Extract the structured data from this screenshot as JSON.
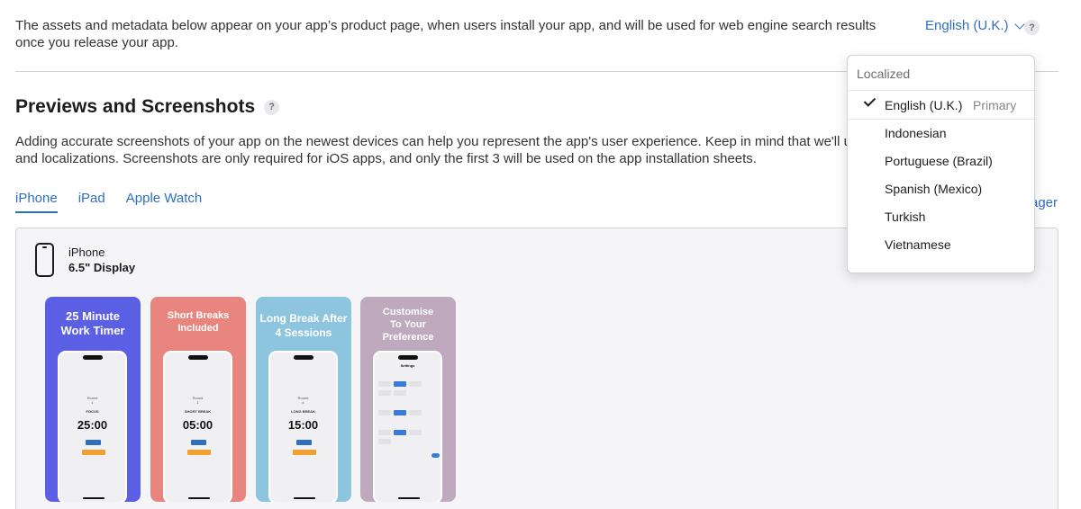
{
  "header": {
    "intro_text": "The assets and metadata below appear on your app’s product page, when users install your app, and will be used for web engine search results once you release your app.",
    "language_selected": "English (U.K.)",
    "help_glyph": "?"
  },
  "section": {
    "title": "Previews and Screenshots",
    "help_glyph": "?",
    "description": "Adding accurate screenshots of your app on the newest devices can help you represent the app's user experience. Keep in mind that we'll use thes",
    "description_tail": "and localizations. Screenshots are only required for iOS apps, and only the first 3 will be used on the app installation sheets."
  },
  "tabs": [
    {
      "label": "iPhone",
      "active": true
    },
    {
      "label": "iPad",
      "active": false
    },
    {
      "label": "Apple Watch",
      "active": false
    }
  ],
  "manager_link_partial": "ager",
  "device": {
    "name": "iPhone",
    "display": "6.5\" Display",
    "icon": "iphone-outline-icon"
  },
  "screenshots": [
    {
      "caption_line1": "25 Minute",
      "caption_line2": "Work Timer",
      "round_label": "Round",
      "round_num": "1",
      "mode": "FOCUS",
      "time": "25:00",
      "bg": "#5b5fe3"
    },
    {
      "caption_line1": "Short Breaks",
      "caption_line2": "Included",
      "round_label": "Round",
      "round_num": "1",
      "mode": "SHORT BREAK",
      "time": "05:00",
      "bg": "#e9857f"
    },
    {
      "caption_line1": "Long Break After",
      "caption_line2": "4 Sessions",
      "round_label": "Round",
      "round_num": "4",
      "mode": "LONG BREAK",
      "time": "15:00",
      "bg": "#8ec5de"
    },
    {
      "caption_line1": "Customise",
      "caption_line2": "To Your",
      "caption_line3": "Preference",
      "settings_title": "Settings",
      "bg": "#bfa9bf"
    }
  ],
  "dropdown": {
    "header": "Localized",
    "primary_tag": "Primary",
    "items": [
      {
        "label": "English (U.K.)",
        "selected": true
      },
      {
        "label": "Indonesian",
        "selected": false
      },
      {
        "label": "Portuguese (Brazil)",
        "selected": false
      },
      {
        "label": "Spanish (Mexico)",
        "selected": false
      },
      {
        "label": "Turkish",
        "selected": false
      },
      {
        "label": "Vietnamese",
        "selected": false
      }
    ]
  },
  "colors": {
    "link_blue": "#2f6ec0",
    "panel_bg": "#f5f5f7",
    "border": "#d2d2d7"
  }
}
